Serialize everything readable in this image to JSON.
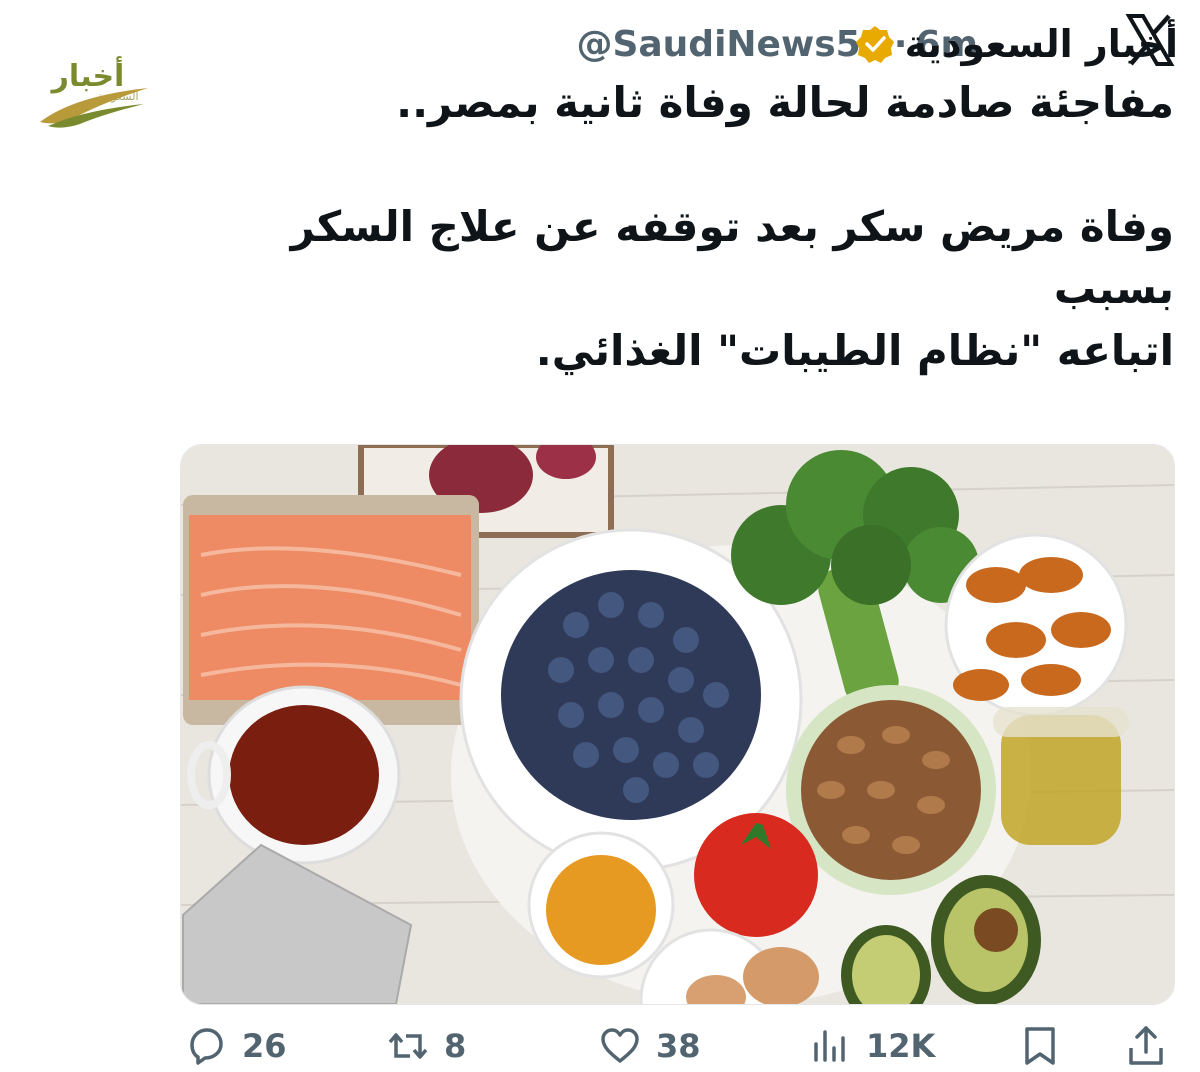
{
  "app": {
    "logo_icon": "x-logo-icon"
  },
  "author": {
    "display_name": "أخبار السعودية",
    "verified": true,
    "verified_color": "#f4b400",
    "handle": "@SaudiNews50",
    "separator": "·",
    "time": "6m",
    "avatar_text": "أخبار",
    "avatar_subtext": "السعودية",
    "avatar_color": "#7a8a2e"
  },
  "tweet": {
    "line1": "مفاجئة صادمة لحالة وفاة ثانية بمصر..",
    "line2": "وفاة مريض سكر بعد توقفه عن علاج السكر بسبب",
    "line3": "اتباعه \"نظام الطيبات\" الغذائي.",
    "line4": "-"
  },
  "media": {
    "description_icon": "food-photo"
  },
  "actions": {
    "replies": "26",
    "reposts": "8",
    "likes": "38",
    "views": "12K",
    "icon_color": "#536471"
  }
}
